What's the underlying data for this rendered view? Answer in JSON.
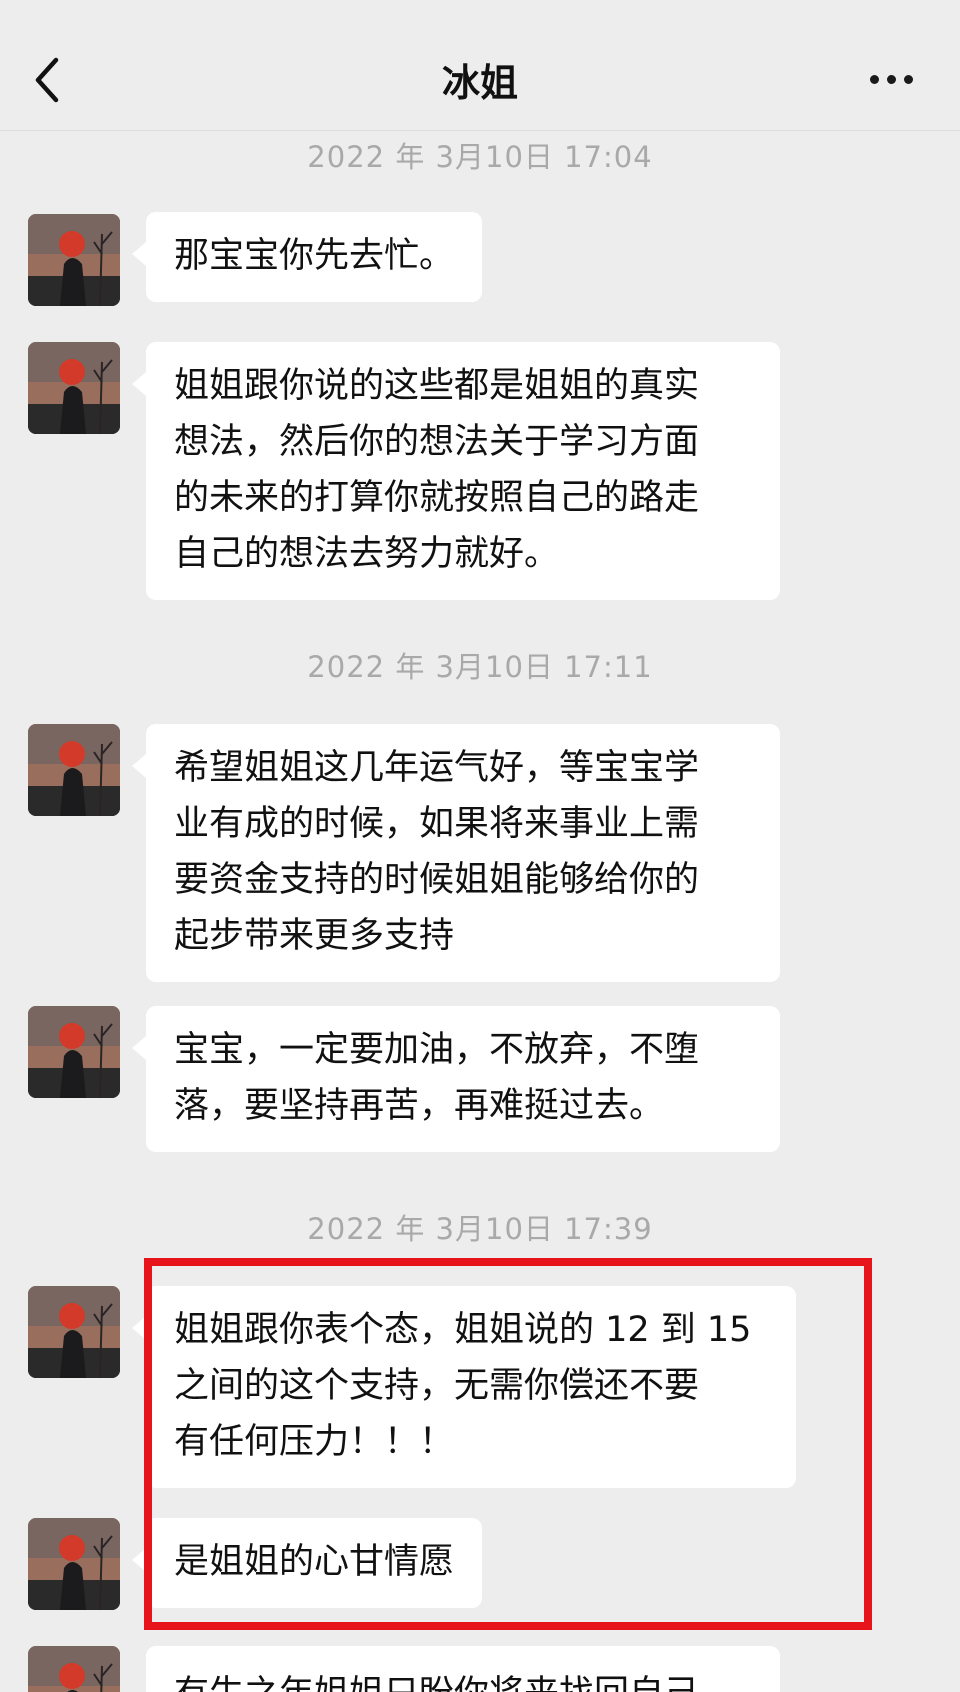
{
  "header": {
    "title": "冰姐",
    "back_icon": "chevron-left-icon",
    "more_icon": "more-dots-icon"
  },
  "timestamps": [
    "2022 年 3月10日 17:04",
    "2022 年 3月10日 17:11",
    "2022 年 3月10日 17:39"
  ],
  "messages": [
    {
      "lines": [
        "那宝宝你先去忙。"
      ]
    },
    {
      "lines": [
        "姐姐跟你说的这些都是姐姐的真实",
        "想法，然后你的想法关于学习方面",
        "的未来的打算你就按照自己的路走",
        "自己的想法去努力就好。"
      ]
    },
    {
      "lines": [
        "希望姐姐这几年运气好，等宝宝学",
        "业有成的时候，如果将来事业上需",
        "要资金支持的时候姐姐能够给你的",
        "起步带来更多支持"
      ]
    },
    {
      "lines": [
        "宝宝，一定要加油，不放弃，不堕",
        "落，要坚持再苦，再难挺过去。"
      ]
    },
    {
      "lines": [
        "姐姐跟你表个态，姐姐说的 12 到 15",
        "之间的这个支持，无需你偿还不要",
        "有任何压力！！！"
      ]
    },
    {
      "lines": [
        "是姐姐的心甘情愿"
      ]
    },
    {
      "lines": [
        "有生之年姐姐只盼你将来找回自己"
      ]
    }
  ],
  "highlight_color": "#e8141b"
}
